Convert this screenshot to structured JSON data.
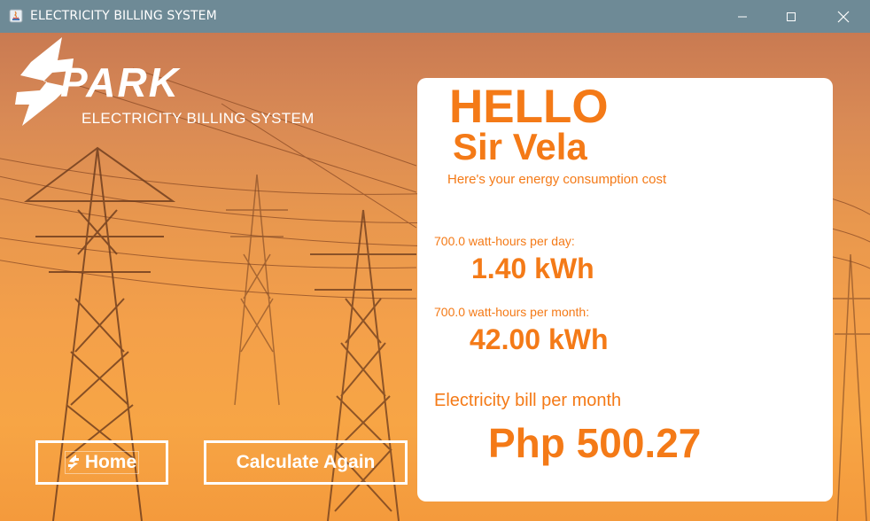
{
  "window": {
    "title": "ELECTRICITY BILLING SYSTEM",
    "icons": [
      "java-app-icon",
      "minimize-icon",
      "maximize-icon",
      "close-icon"
    ]
  },
  "brand": {
    "name": "PARK",
    "subtitle": "ELECTRICITY BILLING SYSTEM",
    "logo_icon": "lightning-s-logo-icon"
  },
  "card": {
    "greeting": "HELLO",
    "customer_name": "Sir Vela",
    "intro": "Here's your energy consumption cost",
    "daily_label": "700.0 watt-hours per day:",
    "daily_value": "1.40 kWh",
    "monthly_label": "700.0 watt-hours per month:",
    "monthly_value": "42.00 kWh",
    "bill_label": "Electricity bill per month",
    "bill_value": "Php 500.27"
  },
  "buttons": {
    "home_label": "Home",
    "home_icon": "lightning-s-small-icon",
    "calculate_label": "Calculate Again"
  },
  "colors": {
    "accent": "#f47a17",
    "titlebar": "#6e8a96",
    "card_bg": "#ffffff"
  }
}
